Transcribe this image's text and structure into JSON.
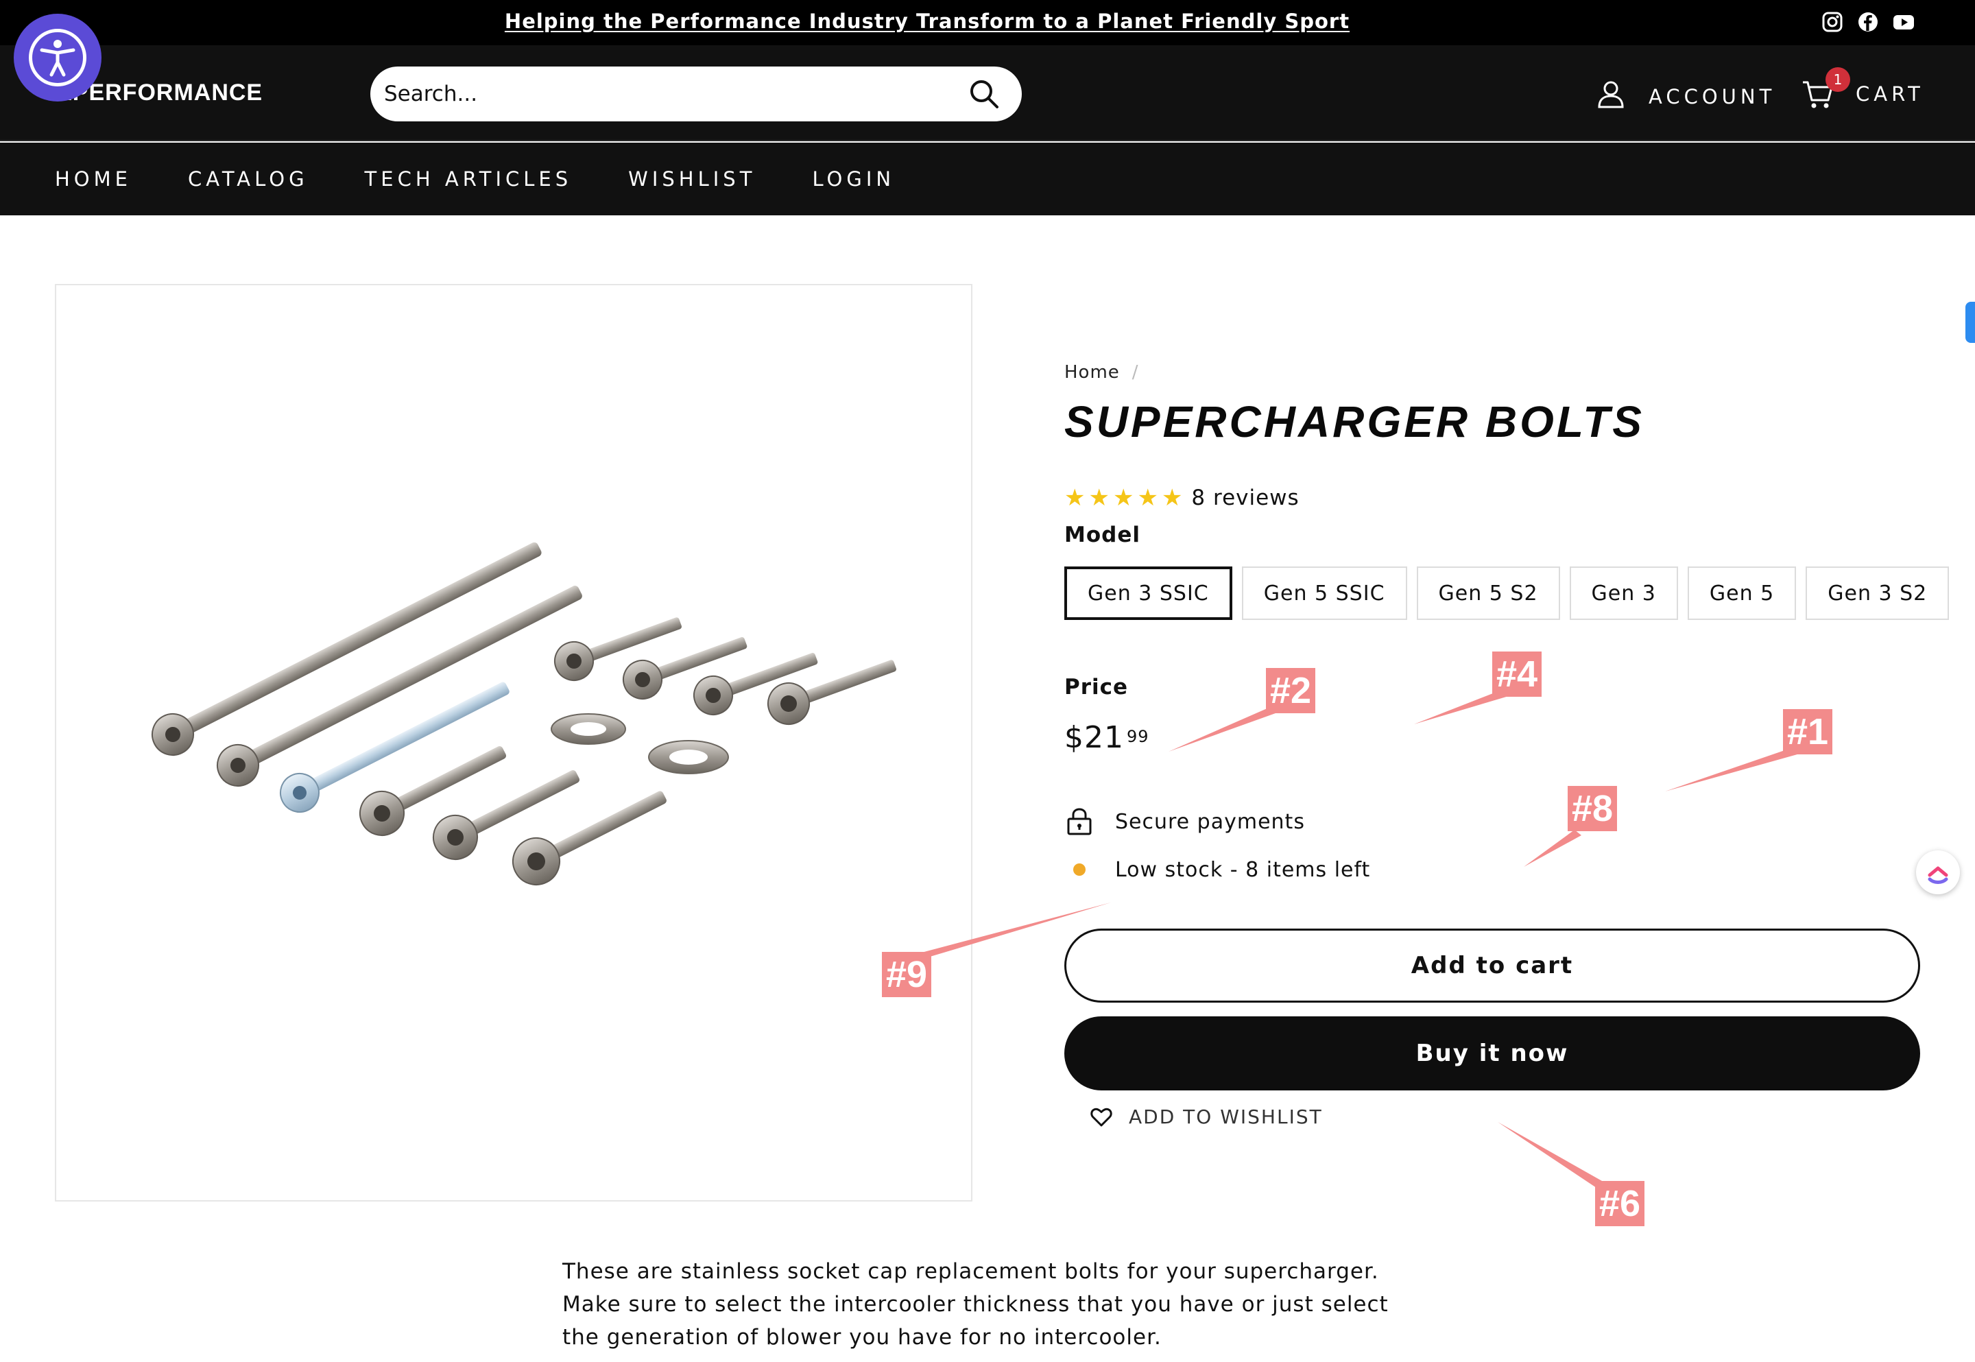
{
  "announcement": {
    "text": "Helping the Performance Industry Transform to a Planet Friendly Sport"
  },
  "social": [
    "instagram-icon",
    "facebook-icon",
    "youtube-icon"
  ],
  "header": {
    "logo": "ZPERFORMANCE",
    "search_placeholder": "Search...",
    "account_label": "ACCOUNT",
    "cart_label": "CART",
    "cart_count": "1"
  },
  "nav": [
    "HOME",
    "CATALOG",
    "TECH ARTICLES",
    "WISHLIST",
    "LOGIN"
  ],
  "breadcrumb": {
    "home": "Home",
    "separator": "/"
  },
  "product": {
    "title": "SUPERCHARGER BOLTS",
    "stars": [
      "★",
      "★",
      "★",
      "★",
      "★"
    ],
    "reviews": "8 reviews",
    "model_label": "Model",
    "variants": [
      "Gen 3 SSIC",
      "Gen 5 SSIC",
      "Gen 5 S2",
      "Gen 3",
      "Gen 5",
      "Gen 3 S2"
    ],
    "selected_variant": "Gen 3 SSIC",
    "price_label": "Price",
    "price_main": "$21",
    "price_cents": "99",
    "secure_payments": "Secure payments",
    "stock": "Low stock - 8 items left",
    "add_to_cart": "Add to cart",
    "buy_now": "Buy it now",
    "add_to_wishlist": "ADD TO WISHLIST",
    "description": "These are stainless socket cap replacement bolts for your supercharger. Make sure to select the intercooler thickness that you have or just select the generation of blower you have for no intercooler."
  },
  "markers": [
    "#2",
    "#4",
    "#1",
    "#8",
    "#9",
    "#6"
  ],
  "colors": {
    "header_bg": "#111111",
    "accent_button": "#0e0e0e",
    "star": "#f5c518",
    "stock_dot": "#f0a928",
    "cart_badge": "#d0303a",
    "accessibility": "#5b4bd6",
    "marker": "#f28b8b"
  }
}
